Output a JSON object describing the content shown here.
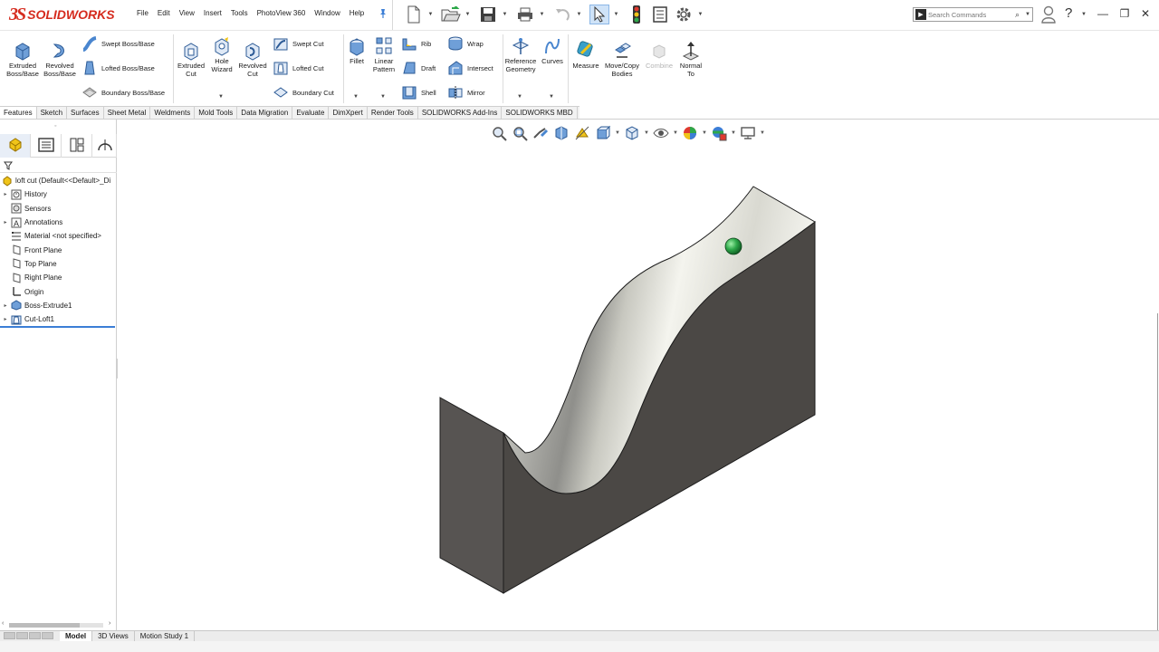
{
  "app": {
    "brand": "SOLIDWORKS",
    "brand_prefix": "3S"
  },
  "menu": [
    "File",
    "Edit",
    "View",
    "Insert",
    "Tools",
    "PhotoView 360",
    "Window",
    "Help"
  ],
  "search": {
    "placeholder": "Search Commands"
  },
  "help": {
    "glyph": "?"
  },
  "window_controls": {
    "minimize": "—",
    "restore": "❐",
    "close": "✕"
  },
  "commands": {
    "extruded_boss": "Extruded Boss/Base",
    "revolved_boss": "Revolved Boss/Base",
    "swept_boss": "Swept Boss/Base",
    "lofted_boss": "Lofted Boss/Base",
    "boundary_boss": "Boundary Boss/Base",
    "extruded_cut": "Extruded Cut",
    "hole_wizard": "Hole Wizard",
    "revolved_cut": "Revolved Cut",
    "swept_cut": "Swept Cut",
    "lofted_cut": "Lofted Cut",
    "boundary_cut": "Boundary Cut",
    "fillet": "Fillet",
    "linear_pattern": "Linear Pattern",
    "rib": "Rib",
    "wrap": "Wrap",
    "draft": "Draft",
    "intersect": "Intersect",
    "shell": "Shell",
    "mirror": "Mirror",
    "reference_geometry": "Reference Geometry",
    "curves": "Curves",
    "measure": "Measure",
    "move_copy_bodies": "Move/Copy Bodies",
    "combine": "Combine",
    "normal_to": "Normal To"
  },
  "tabs": [
    "Features",
    "Sketch",
    "Surfaces",
    "Sheet Metal",
    "Weldments",
    "Mold Tools",
    "Data Migration",
    "Evaluate",
    "DimXpert",
    "Render Tools",
    "SOLIDWORKS Add-Ins",
    "SOLIDWORKS MBD"
  ],
  "tree": {
    "root": "loft cut  (Default<<Default>_Di",
    "items": [
      {
        "label": "History",
        "expandable": true,
        "icon": "history-icon"
      },
      {
        "label": "Sensors",
        "expandable": false,
        "icon": "sensors-icon"
      },
      {
        "label": "Annotations",
        "expandable": true,
        "icon": "annotations-icon"
      },
      {
        "label": "Material <not specified>",
        "expandable": false,
        "icon": "material-icon"
      },
      {
        "label": "Front Plane",
        "expandable": false,
        "icon": "plane-icon"
      },
      {
        "label": "Top Plane",
        "expandable": false,
        "icon": "plane-icon"
      },
      {
        "label": "Right Plane",
        "expandable": false,
        "icon": "plane-icon"
      },
      {
        "label": "Origin",
        "expandable": false,
        "icon": "origin-icon"
      },
      {
        "label": "Boss-Extrude1",
        "expandable": true,
        "icon": "boss-extrude-icon"
      },
      {
        "label": "Cut-Loft1",
        "expandable": true,
        "icon": "cut-loft-icon"
      }
    ]
  },
  "bottom_tabs": [
    "Model",
    "3D Views",
    "Motion Study 1"
  ],
  "colors": {
    "brand_red": "#d52b1e",
    "accent_blue": "#3b7ed6",
    "solid_dark": "#4b4845",
    "surface_light": "#eeeee6",
    "point_green": "#2ea84a"
  }
}
